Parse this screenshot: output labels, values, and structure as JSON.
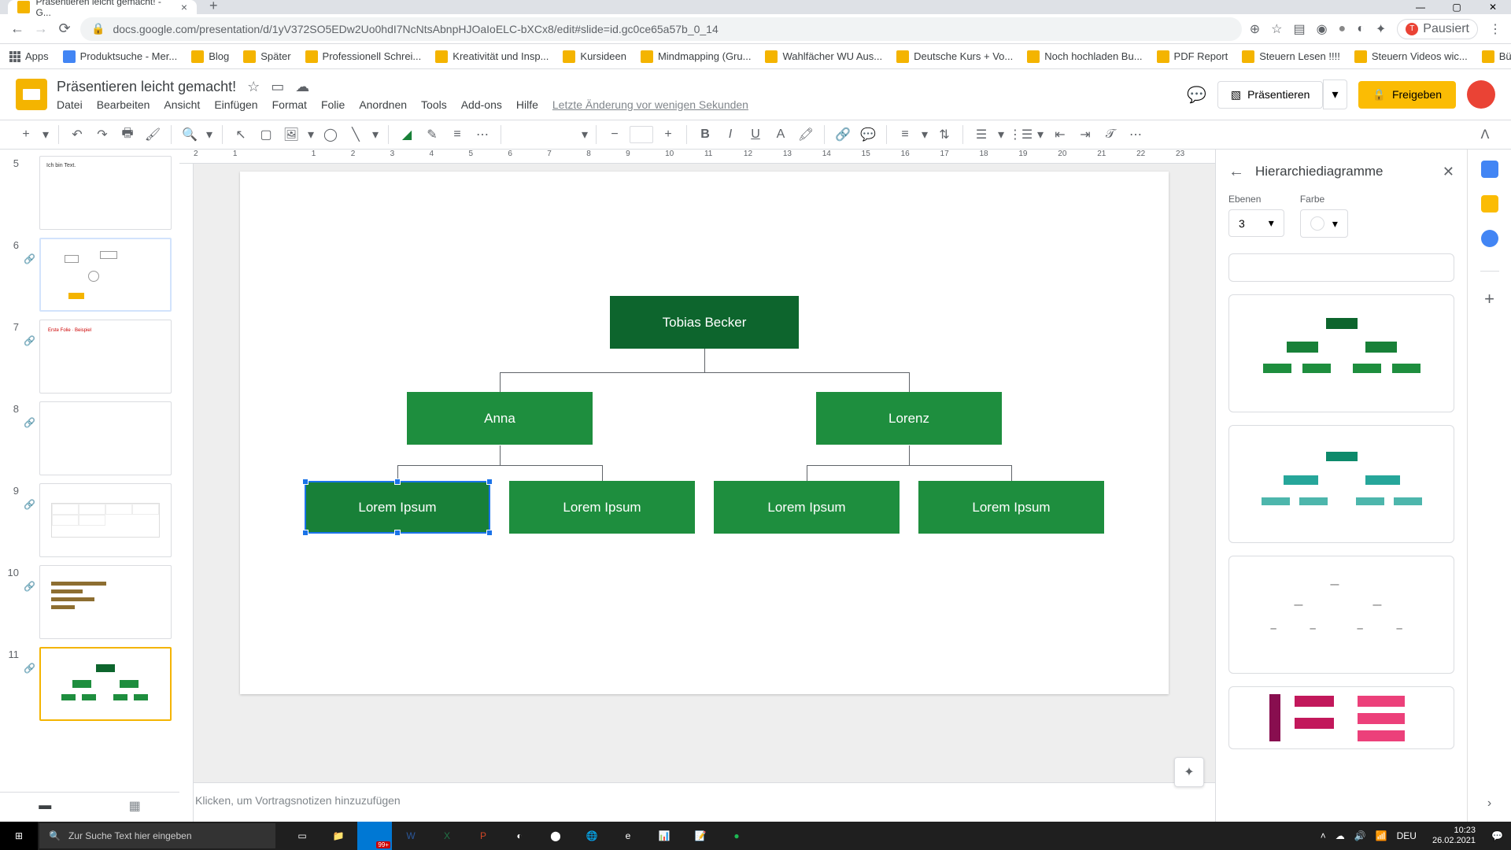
{
  "browser": {
    "tab_title": "Präsentieren leicht gemacht! - G...",
    "url": "docs.google.com/presentation/d/1yV372SO5EDw2Uo0hdI7NcNtsAbnpHJOaIoELC-bXCx8/edit#slide=id.gc0ce65a57b_0_14",
    "paused_label": "Pausiert"
  },
  "bookmarks": [
    "Apps",
    "Produktsuche - Mer...",
    "Blog",
    "Später",
    "Professionell Schrei...",
    "Kreativität und Insp...",
    "Kursideen",
    "Mindmapping (Gru...",
    "Wahlfächer WU Aus...",
    "Deutsche Kurs + Vo...",
    "Noch hochladen Bu...",
    "PDF Report",
    "Steuern Lesen !!!!",
    "Steuern Videos wic...",
    "Büro"
  ],
  "doc": {
    "title": "Präsentieren leicht gemacht!",
    "menus": [
      "Datei",
      "Bearbeiten",
      "Ansicht",
      "Einfügen",
      "Format",
      "Folie",
      "Anordnen",
      "Tools",
      "Add-ons",
      "Hilfe"
    ],
    "last_edit": "Letzte Änderung vor wenigen Sekunden",
    "present": "Präsentieren",
    "share": "Freigeben"
  },
  "filmstrip": {
    "start_num": 5,
    "slides": [
      5,
      6,
      7,
      8,
      9,
      10,
      11
    ]
  },
  "orgchart": {
    "root": "Tobias Becker",
    "level2": [
      "Anna",
      "Lorenz"
    ],
    "level3": [
      "Lorem Ipsum",
      "Lorem Ipsum",
      "Lorem Ipsum",
      "Lorem Ipsum"
    ]
  },
  "notes_placeholder": "Klicken, um Vortragsnotizen hinzuzufügen",
  "sidepanel": {
    "title": "Hierarchiediagramme",
    "levels_label": "Ebenen",
    "levels_value": "3",
    "color_label": "Farbe"
  },
  "ruler": [
    "2",
    "1",
    "",
    "1",
    "2",
    "3",
    "4",
    "5",
    "6",
    "7",
    "8",
    "9",
    "10",
    "11",
    "12",
    "13",
    "14",
    "15",
    "16",
    "17",
    "18",
    "19",
    "20",
    "21",
    "22",
    "23"
  ],
  "taskbar": {
    "search_placeholder": "Zur Suche Text hier eingeben",
    "lang": "DEU",
    "time": "10:23",
    "date": "26.02.2021",
    "mail_count": "99+"
  }
}
